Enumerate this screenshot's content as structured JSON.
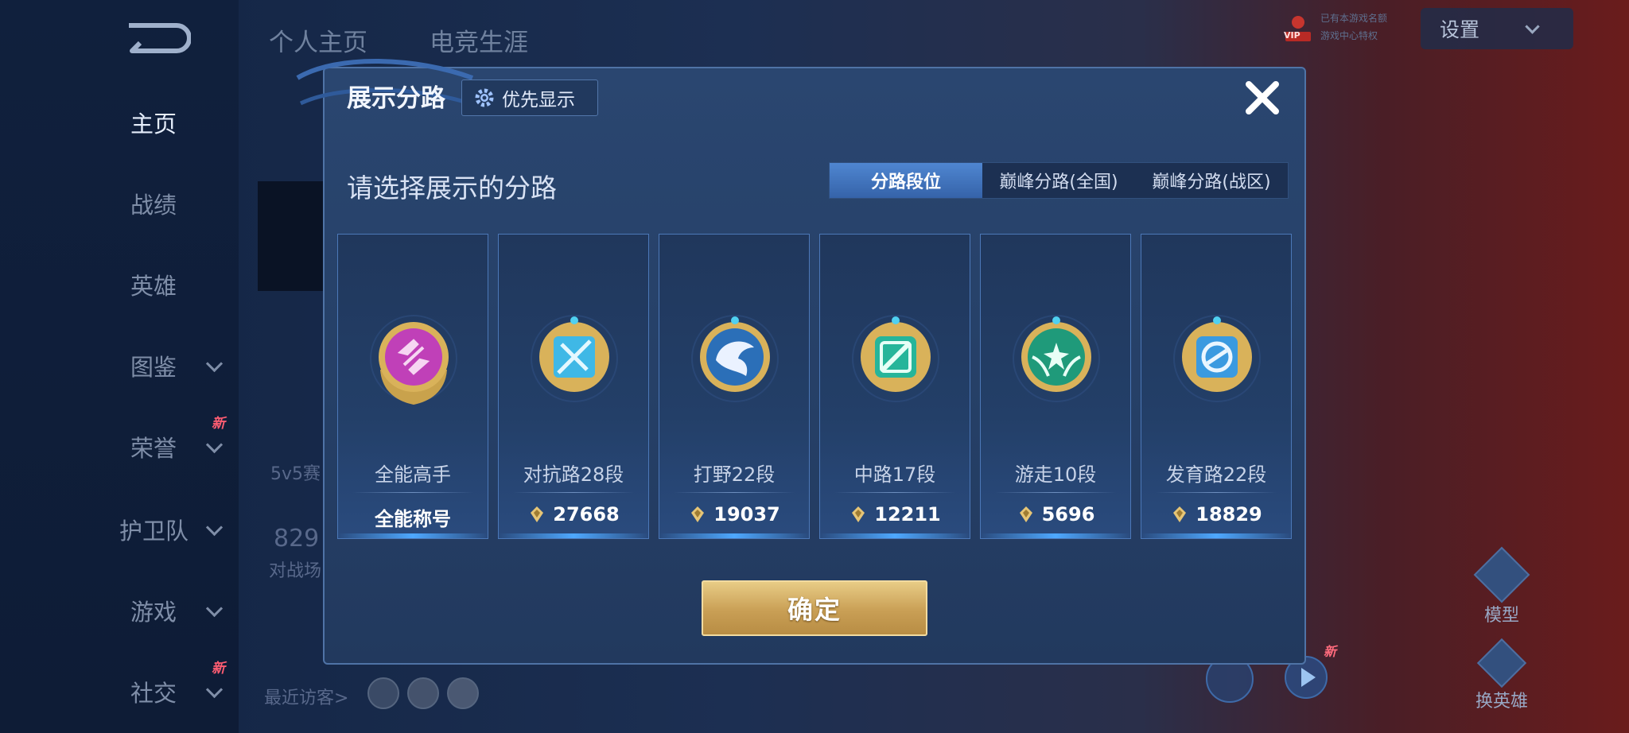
{
  "sidebar": {
    "items": [
      {
        "label": "主页",
        "active": true
      },
      {
        "label": "战绩"
      },
      {
        "label": "英雄"
      },
      {
        "label": "图鉴"
      },
      {
        "label": "荣誉",
        "badge": "新"
      },
      {
        "label": "护卫队"
      },
      {
        "label": "游戏"
      },
      {
        "label": "社交",
        "badge": "新"
      }
    ]
  },
  "background": {
    "tabs": [
      "个人主页",
      "电竞生涯"
    ],
    "mode_label": "5v5赛",
    "stat_value": "829",
    "stat_label": "对战场",
    "recent_visitors": "最近访客>",
    "vip_label": "VIP",
    "vip_text_1": "已有本游戏名额",
    "vip_text_2": "游戏中心特权",
    "badge_new": "新"
  },
  "topbar": {
    "settings_label": "设置"
  },
  "right_buttons": {
    "model_label": "模型",
    "switch_hero_label": "换英雄"
  },
  "dialog": {
    "title": "展示分路",
    "priority_button": "优先显示",
    "subtitle": "请选择展示的分路",
    "tabs": [
      "分路段位",
      "巅峰分路(全国)",
      "巅峰分路(战区)"
    ],
    "selected_tab": "分路段位",
    "cards": [
      {
        "name": "全能高手",
        "value": "全能称号",
        "gem_color": "#c040b8"
      },
      {
        "name": "对抗路28段",
        "value": "27668",
        "gem_color": "#3fb8e6"
      },
      {
        "name": "打野22段",
        "value": "19037",
        "gem_color": "#2b6fb8"
      },
      {
        "name": "中路17段",
        "value": "12211",
        "gem_color": "#26b59a"
      },
      {
        "name": "游走10段",
        "value": "5696",
        "gem_color": "#1f9a7a"
      },
      {
        "name": "发育路22段",
        "value": "18829",
        "gem_color": "#3a9ae0"
      }
    ],
    "confirm_label": "确定"
  }
}
